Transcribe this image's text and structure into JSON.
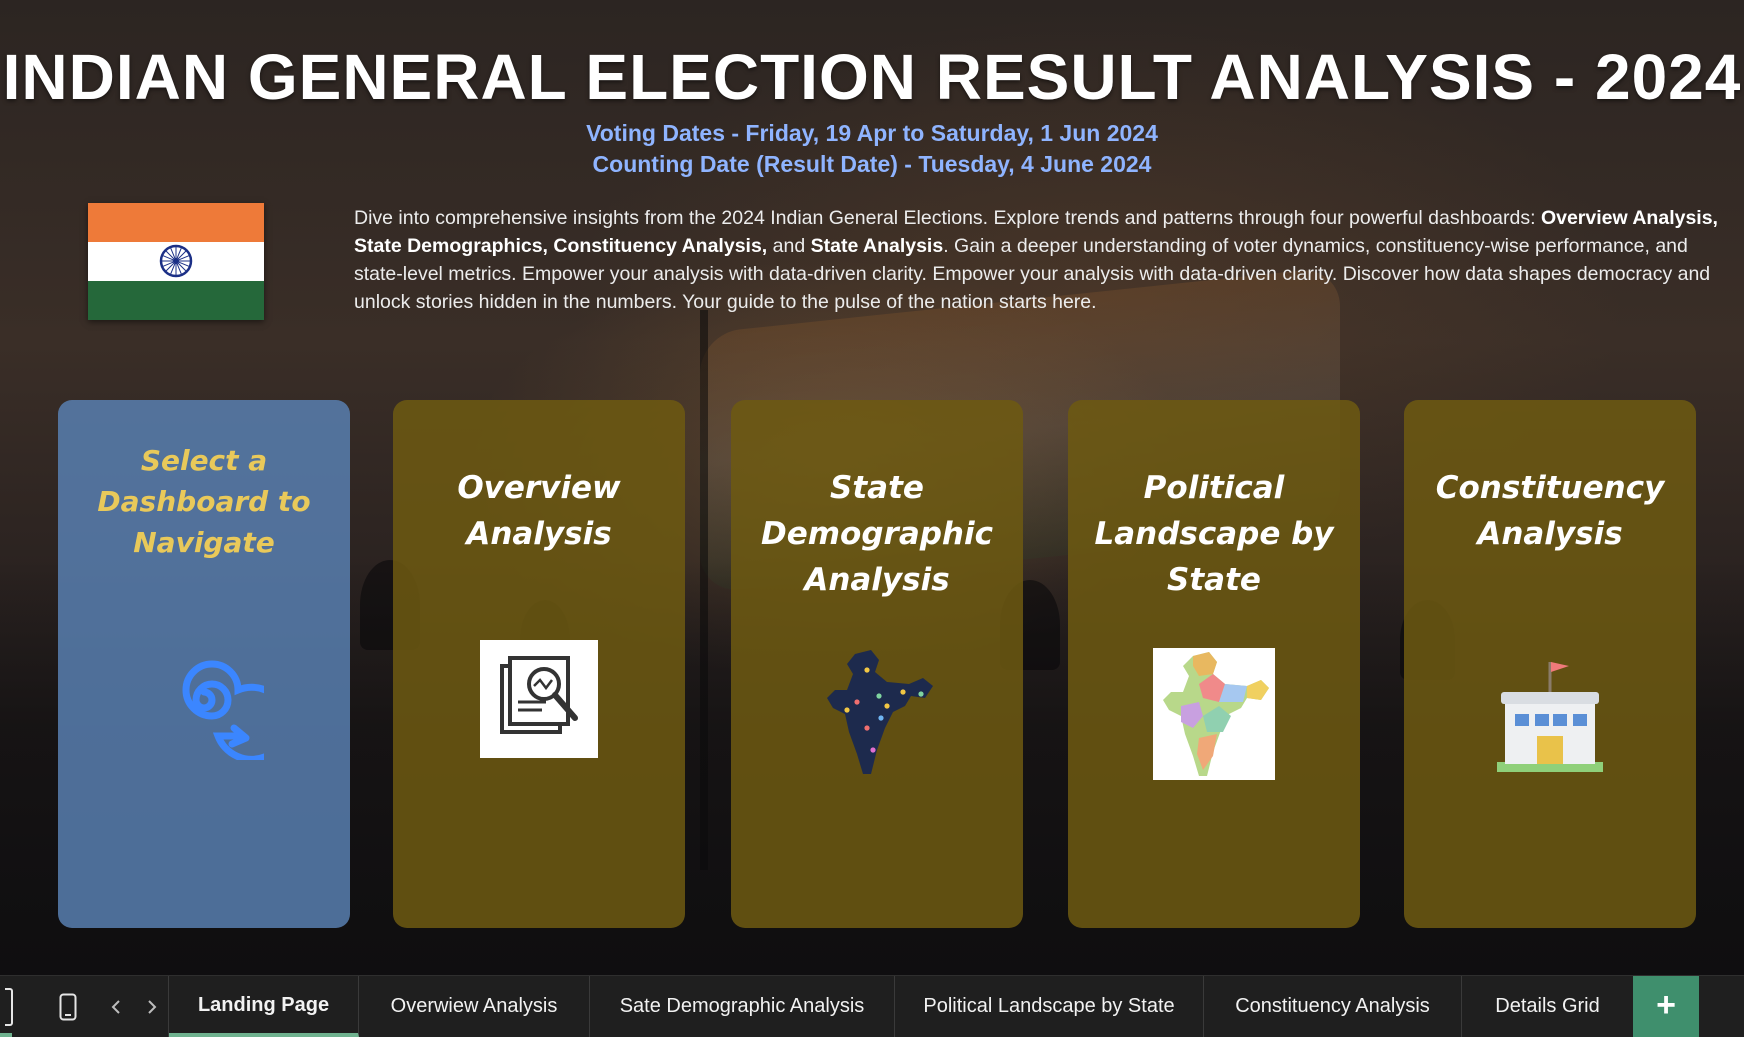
{
  "header": {
    "title": "INDIAN GENERAL ELECTION RESULT ANALYSIS - 2024",
    "voting_dates": "Voting Dates - Friday, 19 Apr to Saturday, 1 Jun 2024",
    "counting_date": "Counting Date (Result Date) - Tuesday, 4 June 2024"
  },
  "intro": {
    "part1": "Dive into comprehensive insights from the 2024 Indian General Elections. Explore trends and patterns through four powerful dashboards: ",
    "bold1": "Overview Analysis, State Demographics, Constituency Analysis,",
    "part2": " and ",
    "bold2": "State Analysis",
    "part3": ". Gain a deeper understanding of voter dynamics, constituency-wise performance, and state-level metrics. Empower your analysis with data-driven clarity. Empower your analysis with data-driven clarity. Discover how data shapes democracy and unlock stories hidden in the numbers. Your guide to the pulse of the nation starts here."
  },
  "cards": {
    "navigate": {
      "line1": "Select a",
      "line2": "Dashboard to",
      "line3": "Navigate"
    },
    "overview": {
      "line1": "Overview",
      "line2": "Analysis"
    },
    "state_demographic": {
      "line1": "State",
      "line2": "Demographic",
      "line3": "Analysis"
    },
    "political": {
      "line1": "Political",
      "line2": "Landscape by",
      "line3": "State"
    },
    "constituency": {
      "line1": "Constituency",
      "line2": "Analysis"
    }
  },
  "sheet_tabs": [
    {
      "label": "Landing Page",
      "active": true
    },
    {
      "label": "Overwiew Analysis",
      "active": false
    },
    {
      "label": "Sate Demographic Analysis",
      "active": false
    },
    {
      "label": "Political Landscape by State",
      "active": false
    },
    {
      "label": "Constituency Analysis",
      "active": false
    },
    {
      "label": "Details Grid",
      "active": false
    }
  ],
  "controls": {
    "add_sheet": "+",
    "icons": [
      "mobile-layout-icon",
      "scroll-left-icon",
      "scroll-right-icon",
      "add-sheet-icon"
    ]
  },
  "colors": {
    "title": "#ffffff",
    "dates": "#8fb4ff",
    "card_gold": "#6e5a12",
    "card_blue": "#587fb0",
    "navigate_text": "#e9c95a",
    "active_tab_underline": "#6fb28f",
    "add_button": "#3f8f6d"
  }
}
